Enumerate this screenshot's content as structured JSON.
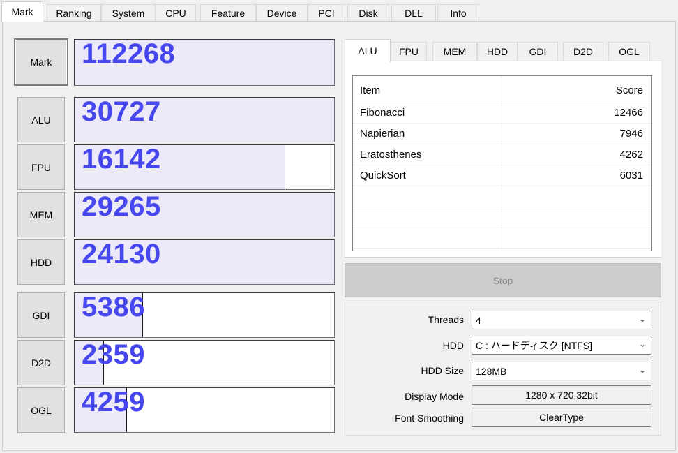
{
  "top_tabs": [
    "Mark",
    "Ranking",
    "System",
    "CPU",
    "Feature",
    "Device",
    "PCI",
    "Disk",
    "DLL",
    "Info"
  ],
  "active_top_tab": "Mark",
  "mark": {
    "label": "Mark",
    "score": "112268",
    "fill": 1.0
  },
  "benchmarks": [
    {
      "label": "ALU",
      "score": "30727",
      "fill": 1.0
    },
    {
      "label": "FPU",
      "score": "16142",
      "fill": 0.81
    },
    {
      "label": "MEM",
      "score": "29265",
      "fill": 1.0
    },
    {
      "label": "HDD",
      "score": "24130",
      "fill": 1.0
    },
    {
      "label": "GDI",
      "score": "5386",
      "fill": 0.26
    },
    {
      "label": "D2D",
      "score": "2359",
      "fill": 0.11
    },
    {
      "label": "OGL",
      "score": "4259",
      "fill": 0.2
    }
  ],
  "sub_tabs": [
    "ALU",
    "FPU",
    "MEM",
    "HDD",
    "GDI",
    "D2D",
    "OGL"
  ],
  "active_sub_tab": "ALU",
  "result_table": {
    "headers": {
      "item": "Item",
      "score": "Score"
    },
    "rows": [
      {
        "item": "Fibonacci",
        "score": "12466"
      },
      {
        "item": "Napierian",
        "score": "7946"
      },
      {
        "item": "Eratosthenes",
        "score": "4262"
      },
      {
        "item": "QuickSort",
        "score": "6031"
      }
    ]
  },
  "stop_label": "Stop",
  "settings": {
    "threads": {
      "label": "Threads",
      "value": "4"
    },
    "hdd": {
      "label": "HDD",
      "value": "C : ハードディスク [NTFS]"
    },
    "hdd_size": {
      "label": "HDD Size",
      "value": "128MB"
    },
    "display_mode": {
      "label": "Display Mode",
      "value": "1280 x 720 32bit"
    },
    "font_smoothing": {
      "label": "Font Smoothing",
      "value": "ClearType"
    }
  },
  "colors": {
    "score_text": "#4747ef",
    "bar_fill": "#eceaf9"
  },
  "icons": {
    "combo_arrow": "chevron-down-icon"
  }
}
